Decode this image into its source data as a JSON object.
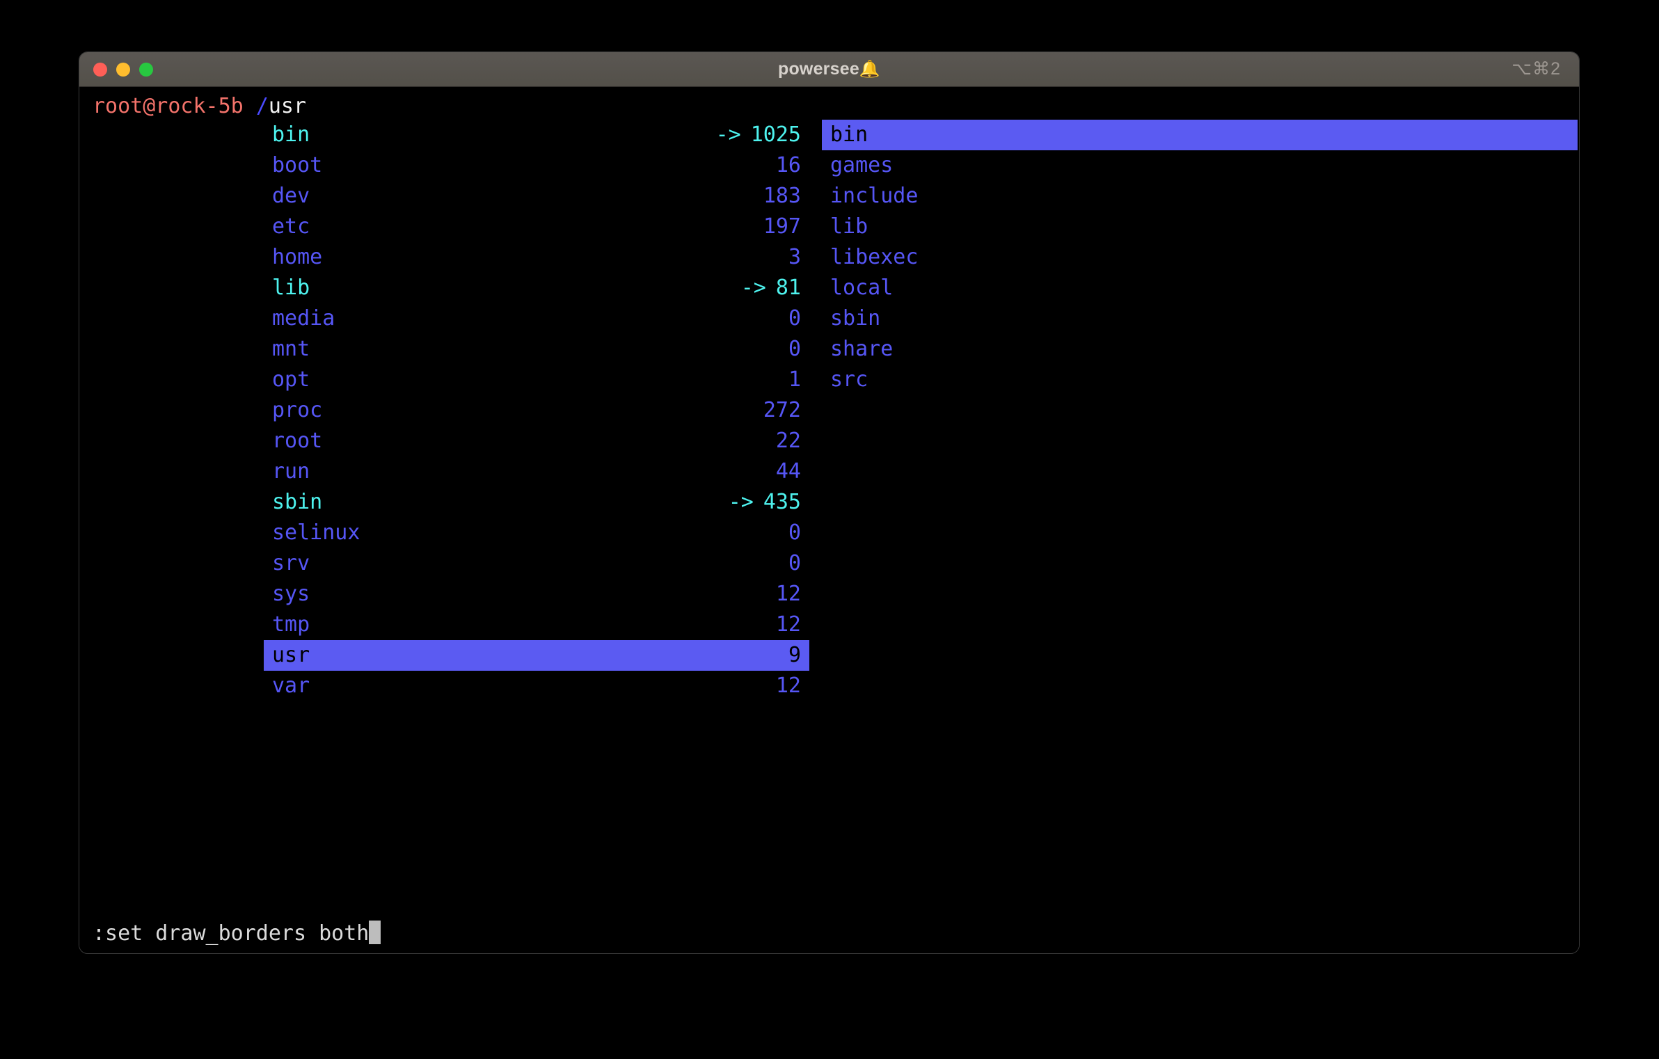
{
  "window": {
    "title": "powersee",
    "title_icon": "bell-icon",
    "title_emoji": "🔔",
    "shortcut": "⌥⌘2",
    "controls": [
      {
        "name": "close",
        "color": "#ff5f57"
      },
      {
        "name": "minimize",
        "color": "#ffbd2e"
      },
      {
        "name": "zoom",
        "color": "#28c840"
      }
    ]
  },
  "prompt": {
    "user_host": "root@rock-5b",
    "path_sep": "/",
    "path": "usr"
  },
  "colors": {
    "background": "#000000",
    "titlebar": "#56524d",
    "directory": "#5656f5",
    "symlink": "#4ef2ee",
    "selection": "#5b5bf2",
    "selection_text": "#000000",
    "prompt_user": "#f4736b",
    "prompt_path": "#f2f2f2",
    "cmdline_text": "#dcdcdc",
    "cursor": "#bdbdbd"
  },
  "panes": {
    "left": {
      "path": "/",
      "selected_index": 17,
      "entries": [
        {
          "name": "bin",
          "count": "1025",
          "symlink": true,
          "selected": false
        },
        {
          "name": "boot",
          "count": "16",
          "symlink": false,
          "selected": false
        },
        {
          "name": "dev",
          "count": "183",
          "symlink": false,
          "selected": false
        },
        {
          "name": "etc",
          "count": "197",
          "symlink": false,
          "selected": false
        },
        {
          "name": "home",
          "count": "3",
          "symlink": false,
          "selected": false
        },
        {
          "name": "lib",
          "count": "81",
          "symlink": true,
          "selected": false
        },
        {
          "name": "media",
          "count": "0",
          "symlink": false,
          "selected": false
        },
        {
          "name": "mnt",
          "count": "0",
          "symlink": false,
          "selected": false
        },
        {
          "name": "opt",
          "count": "1",
          "symlink": false,
          "selected": false
        },
        {
          "name": "proc",
          "count": "272",
          "symlink": false,
          "selected": false
        },
        {
          "name": "root",
          "count": "22",
          "symlink": false,
          "selected": false
        },
        {
          "name": "run",
          "count": "44",
          "symlink": false,
          "selected": false
        },
        {
          "name": "sbin",
          "count": "435",
          "symlink": true,
          "selected": false
        },
        {
          "name": "selinux",
          "count": "0",
          "symlink": false,
          "selected": false
        },
        {
          "name": "srv",
          "count": "0",
          "symlink": false,
          "selected": false
        },
        {
          "name": "sys",
          "count": "12",
          "symlink": false,
          "selected": false
        },
        {
          "name": "tmp",
          "count": "12",
          "symlink": false,
          "selected": false
        },
        {
          "name": "usr",
          "count": "9",
          "symlink": false,
          "selected": true
        },
        {
          "name": "var",
          "count": "12",
          "symlink": false,
          "selected": false
        }
      ]
    },
    "right": {
      "path": "/usr",
      "selected_index": 0,
      "entries": [
        {
          "name": "bin",
          "count": "",
          "symlink": false,
          "selected": true
        },
        {
          "name": "games",
          "count": "",
          "symlink": false,
          "selected": false
        },
        {
          "name": "include",
          "count": "",
          "symlink": false,
          "selected": false
        },
        {
          "name": "lib",
          "count": "",
          "symlink": false,
          "selected": false
        },
        {
          "name": "libexec",
          "count": "",
          "symlink": false,
          "selected": false
        },
        {
          "name": "local",
          "count": "",
          "symlink": false,
          "selected": false
        },
        {
          "name": "sbin",
          "count": "",
          "symlink": false,
          "selected": false
        },
        {
          "name": "share",
          "count": "",
          "symlink": false,
          "selected": false
        },
        {
          "name": "src",
          "count": "",
          "symlink": false,
          "selected": false
        }
      ]
    }
  },
  "symlink_arrow": "->",
  "command_line": {
    "text": ":set draw_borders both",
    "cursor": true
  }
}
